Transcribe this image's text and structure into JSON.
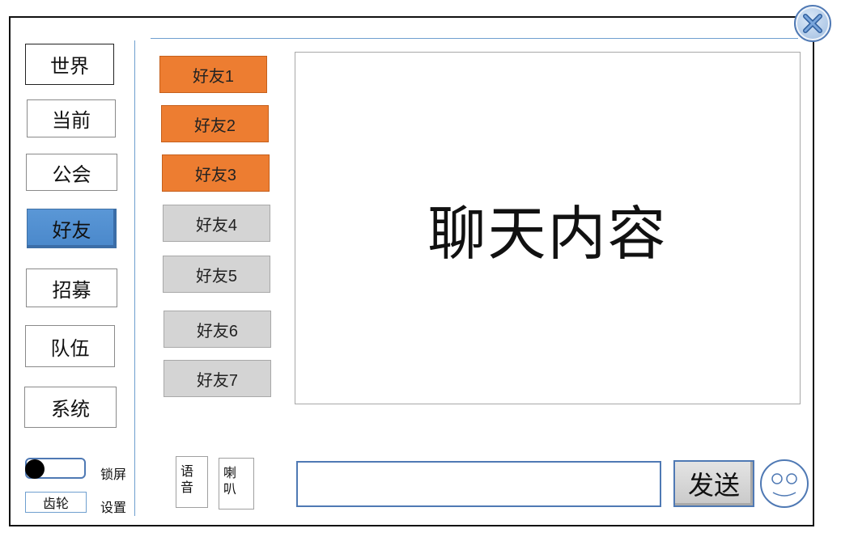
{
  "channels": [
    {
      "label": "世界",
      "active": false
    },
    {
      "label": "当前",
      "active": false
    },
    {
      "label": "公会",
      "active": false
    },
    {
      "label": "好友",
      "active": true
    },
    {
      "label": "招募",
      "active": false
    },
    {
      "label": "队伍",
      "active": false
    },
    {
      "label": "系统",
      "active": false
    }
  ],
  "friends": [
    {
      "label": "好友1",
      "online": true
    },
    {
      "label": "好友2",
      "online": true
    },
    {
      "label": "好友3",
      "online": true
    },
    {
      "label": "好友4",
      "online": false
    },
    {
      "label": "好友5",
      "online": false
    },
    {
      "label": "好友6",
      "online": false
    },
    {
      "label": "好友7",
      "online": false
    }
  ],
  "chat": {
    "content_text": "聊天内容"
  },
  "bottom": {
    "lock_label": "锁屏",
    "gear_label": "齿轮",
    "settings_label": "设置",
    "voice_label": "语音",
    "horn_label": "喇叭",
    "send_label": "发送",
    "input_value": ""
  },
  "colors": {
    "online": "#ed7d31",
    "offline": "#d4d4d4",
    "active_channel": "#5a97d6",
    "accent_line": "#6f9fcf"
  },
  "icons": {
    "close": "close-icon",
    "emoji": "smiley-icon"
  }
}
